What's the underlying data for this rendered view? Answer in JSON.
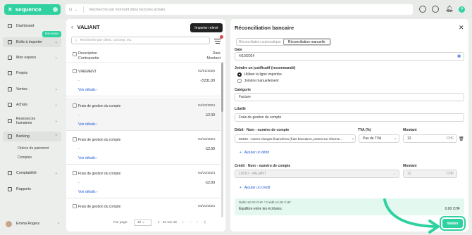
{
  "brand": {
    "name": "sequence"
  },
  "search": {
    "scope": "Q",
    "placeholder": "Recherche par montant dans factures achats"
  },
  "sidebar": {
    "items": [
      {
        "label": "Dashboard"
      },
      {
        "label": "Boîte à importer"
      },
      {
        "label": "Mon espace"
      },
      {
        "label": "Projets"
      },
      {
        "label": "Ventes"
      },
      {
        "label": "Achats"
      },
      {
        "label": "Ressources humaines"
      },
      {
        "label": "Banking"
      },
      {
        "label": "Comptabilité"
      },
      {
        "label": "Rapports"
      }
    ],
    "badge": "Nouveau",
    "subitems": [
      "Ordres de paiement",
      "Comptes"
    ],
    "user": "Emma Rogers"
  },
  "middle": {
    "title": "VALIANT",
    "import_label": "Importer relevé",
    "search_placeholder": "Recherche par client, concept, etc.",
    "headers": {
      "desc": "Description",
      "counterpart": "Contrepartie",
      "date": "Date",
      "amount": "Montant"
    },
    "rows": [
      {
        "label": "VIREMENT",
        "date": "01/01/2026",
        "dash": "-",
        "amount": "-3'231.00",
        "link": "Voir détails"
      },
      {
        "label": "Frais de gestion du compte",
        "date": "04/10/2024",
        "dash": "-",
        "amount": "-12.00",
        "link": "Voir détails"
      },
      {
        "label": "Frais de gestion du compte",
        "date": "04/10/2024",
        "dash": "-",
        "amount": "-12.00",
        "link": "Voir détails"
      },
      {
        "label": "Frais de gestion du compte",
        "date": "04/10/2024",
        "dash": "-",
        "amount": "-12.00",
        "link": "Voir détails"
      },
      {
        "label": "Frais de gestion du compte",
        "date": "04/10/2024"
      }
    ],
    "pager": {
      "per_page_label": "Par page:",
      "per_page": "10",
      "range": "1 - 10 sur 49"
    }
  },
  "right": {
    "title": "Réconciliation bancaire",
    "tabs": [
      "Réconciliation automatique",
      "Réconciliation manuelle"
    ],
    "date_label": "Date",
    "date_value": "4/10/2024",
    "justif_label": "Joindre un justificatif (recommandé)",
    "radio1": "Utiliser la ligne importée",
    "radio2": "Joindre manuellement",
    "cat_label": "Catégorie",
    "cat_value": "Facture",
    "libelle_label": "Libellé",
    "libelle_value": "Frais de gestion du compte",
    "debit_label": "Débit · Nom - numéro de compte",
    "tva_label": "TVA (%)",
    "montant_label": "Montant",
    "debit_value": "69400 - Autres charges financières (frais bancaires, pertes sur réserve...",
    "tva_value": "Pas de TVA",
    "debit_amount": "12",
    "currency": "CHF",
    "add_debit": "Ajouter un débit",
    "credit_label": "Crédit · Nom - numéro de compte",
    "credit_value": "10010 - VALIANT",
    "credit_amount": "12",
    "add_credit": "Ajouter un crédit",
    "summary_line": "Débit 12.00 CHF / Crédit 12.00 CHF",
    "summary_text": "Équilibre entre les écritures.",
    "summary_amount": "0.00 CHF",
    "validate": "Valider"
  },
  "colors": {
    "accent": "#2fd1a1",
    "link": "#1f5ad8",
    "alert": "#e24545"
  }
}
